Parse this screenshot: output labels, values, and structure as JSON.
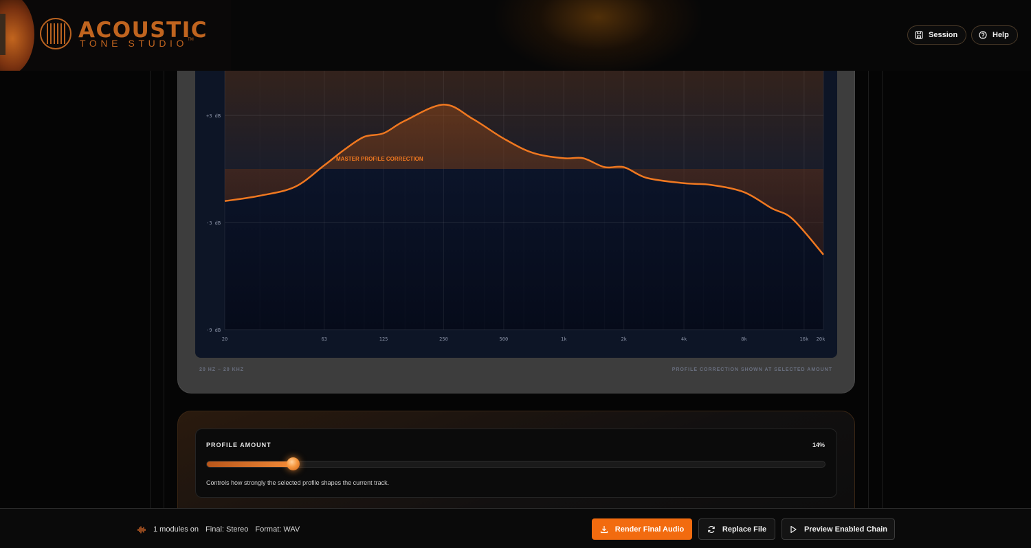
{
  "header": {
    "brand_title": "ACOUSTIC",
    "brand_subtitle": "TONE STUDIO",
    "brand_tm": "TM",
    "session_label": "Session",
    "help_label": "Help"
  },
  "chart": {
    "annotation": "MASTER PROFILE CORRECTION",
    "foot_left": "20 HZ – 20 KHZ",
    "foot_right": "PROFILE CORRECTION SHOWN AT SELECTED AMOUNT"
  },
  "chart_data": {
    "type": "line",
    "x_scale": "log",
    "y_ticks": [
      {
        "v": 3,
        "label": "+3 dB"
      },
      {
        "v": -3,
        "label": "-3 dB"
      },
      {
        "v": -9,
        "label": "-9 dB"
      }
    ],
    "x_ticks": [
      {
        "v": 20,
        "label": "20"
      },
      {
        "v": 63,
        "label": "63"
      },
      {
        "v": 125,
        "label": "125"
      },
      {
        "v": 250,
        "label": "250"
      },
      {
        "v": 500,
        "label": "500"
      },
      {
        "v": 1000,
        "label": "1k"
      },
      {
        "v": 2000,
        "label": "2k"
      },
      {
        "v": 4000,
        "label": "4k"
      },
      {
        "v": 8000,
        "label": "8k"
      },
      {
        "v": 16000,
        "label": "16k"
      },
      {
        "v": 20000,
        "label": "20k"
      }
    ],
    "xlim": [
      20,
      20000
    ],
    "ylim": [
      -9,
      6
    ],
    "series": [
      {
        "points": [
          [
            20,
            -1.8
          ],
          [
            30,
            -1.5
          ],
          [
            45,
            -1.0
          ],
          [
            63,
            0.2
          ],
          [
            80,
            1.1
          ],
          [
            100,
            1.8
          ],
          [
            125,
            2.0
          ],
          [
            160,
            2.7
          ],
          [
            250,
            3.6
          ],
          [
            350,
            2.8
          ],
          [
            500,
            1.7
          ],
          [
            700,
            0.9
          ],
          [
            1000,
            0.6
          ],
          [
            1250,
            0.6
          ],
          [
            1600,
            0.1
          ],
          [
            2000,
            0.1
          ],
          [
            2600,
            -0.5
          ],
          [
            4000,
            -0.8
          ],
          [
            5500,
            -0.9
          ],
          [
            8000,
            -1.3
          ],
          [
            11000,
            -2.2
          ],
          [
            14000,
            -2.8
          ],
          [
            20000,
            -4.8
          ]
        ]
      }
    ],
    "grid": true
  },
  "amount": {
    "label": "PROFILE AMOUNT",
    "value_text": "14%",
    "value": 14,
    "help": "Controls how strongly the selected profile shapes the current track."
  },
  "footer": {
    "modules": "1 modules on",
    "final": "Final: Stereo",
    "format": "Format: WAV",
    "render_label": "Render Final Audio",
    "replace_label": "Replace File",
    "preview_label": "Preview Enabled Chain"
  },
  "colors": {
    "accent": "#f26b0f",
    "curve": "#f07820",
    "brand": "#c0641f"
  }
}
